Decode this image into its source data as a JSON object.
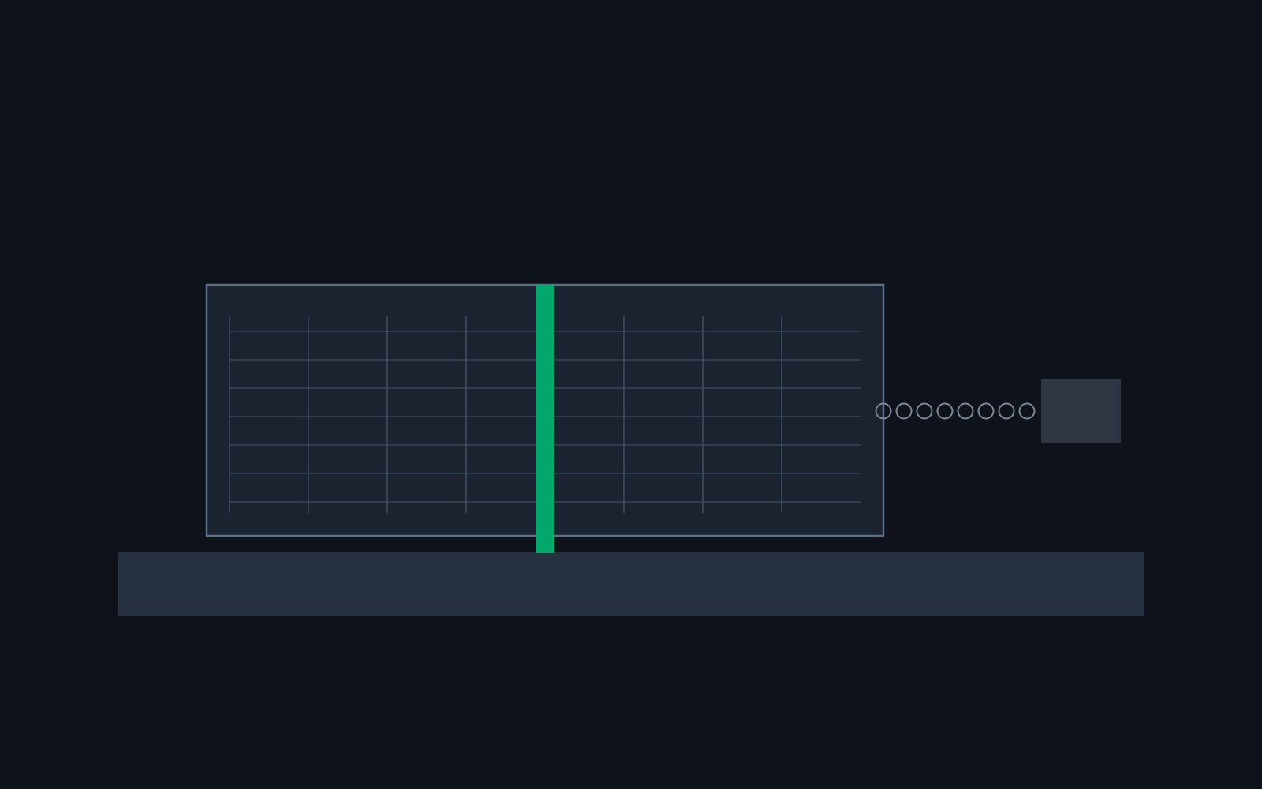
{
  "scene": {
    "colors": {
      "background": "#0e121a",
      "grid_panel_fill": "#1c2330",
      "grid_panel_border": "#5d6f84",
      "grid_line": "#465568",
      "marker_bar": "#00a86b",
      "floor_platform": "#273140",
      "chain_link": "#7f8893",
      "weight_block": "#2e3644"
    },
    "grid": {
      "columns": 8,
      "rows": 7
    },
    "chain": {
      "link_count": 8
    }
  }
}
